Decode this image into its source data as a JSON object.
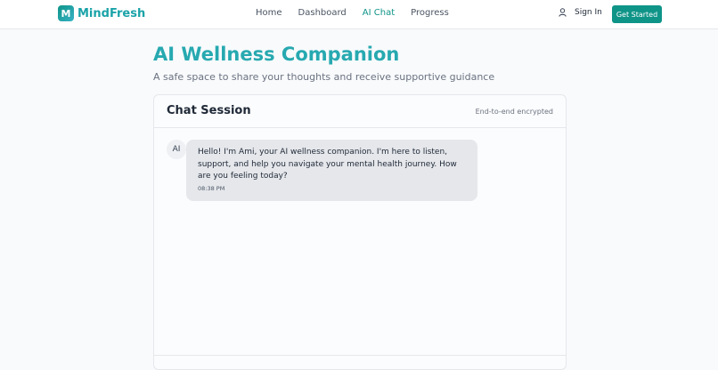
{
  "brand": {
    "logo_letter": "M",
    "name": "MindFresh"
  },
  "nav": {
    "links": [
      {
        "label": "Home",
        "active": false
      },
      {
        "label": "Dashboard",
        "active": false
      },
      {
        "label": "AI Chat",
        "active": true
      },
      {
        "label": "Progress",
        "active": false
      }
    ],
    "signin_label": "Sign In",
    "cta_label": "Get Started"
  },
  "hero": {
    "title": "AI Wellness Companion",
    "subtitle": "A safe space to share your thoughts and receive supportive guidance"
  },
  "chat": {
    "title": "Chat Session",
    "encryption": "End-to-end encrypted",
    "messages": [
      {
        "sender": "AI",
        "text": "Hello! I'm Ami, your AI wellness companion. I'm here to listen, support, and help you navigate your mental health journey. How are you feeling today?",
        "time": "08:38 PM"
      }
    ]
  },
  "colors": {
    "accent": "#0f9488",
    "title_gradient": "#27a9b0",
    "bubble_bg": "#e5e7eb"
  },
  "icons": {
    "signin": "user-icon"
  }
}
